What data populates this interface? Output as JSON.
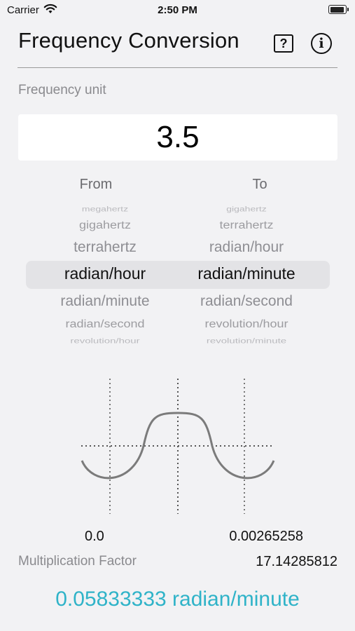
{
  "status_bar": {
    "carrier": "Carrier",
    "time": "2:50 PM"
  },
  "header": {
    "title": "Frequency Conversion",
    "help_symbol": "?",
    "info_symbol": "i"
  },
  "input": {
    "label": "Frequency unit",
    "value": "3.5"
  },
  "picker": {
    "from_header": "From",
    "to_header": "To",
    "from_items": [
      "megahertz",
      "gigahertz",
      "terrahertz",
      "radian/hour",
      "radian/minute",
      "radian/second",
      "revolution/hour"
    ],
    "to_items": [
      "gigahertz",
      "terrahertz",
      "radian/hour",
      "radian/minute",
      "radian/second",
      "revolution/hour",
      "revolution/minute"
    ],
    "from_selected": "radian/hour",
    "to_selected": "radian/minute"
  },
  "graph": {
    "left_value": "0.0",
    "right_value": "0.00265258"
  },
  "multiplication": {
    "label": "Multiplication Factor",
    "value": "17.14285812"
  },
  "result": {
    "text": "0.05833333 radian/minute",
    "color": "#2fb3c8"
  },
  "icons": [
    "wifi-icon",
    "battery-icon",
    "help-icon",
    "info-icon"
  ]
}
